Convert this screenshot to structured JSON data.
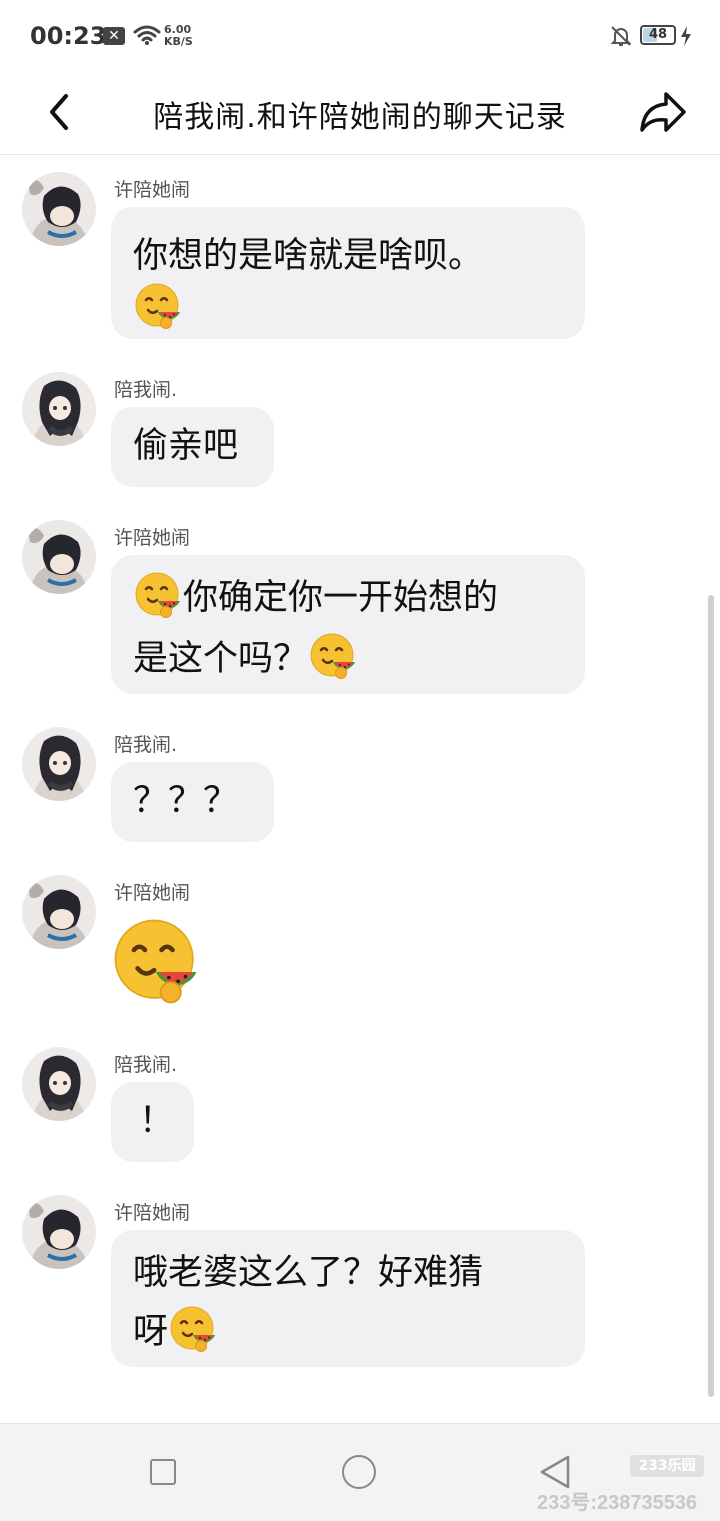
{
  "status_bar": {
    "time": "00:23",
    "notification_badge": "✕",
    "net_speed_value": "6.00",
    "net_speed_unit": "KB/S",
    "battery_level": "48",
    "battery_fraction": 0.48
  },
  "header": {
    "title": "陪我闹.和许陪她闹的聊天记录"
  },
  "messages": [
    {
      "sender": "许陪她闹",
      "line1": "你想的是啥就是啥呗。",
      "line2": ""
    },
    {
      "sender": "陪我闹.",
      "text": "偷亲吧"
    },
    {
      "sender": "许陪她闹",
      "line1": "你确定你一开始想的",
      "line2": "是这个吗？"
    },
    {
      "sender": "陪我闹.",
      "text": "？？？"
    },
    {
      "sender": "许陪她闹"
    },
    {
      "sender": "陪我闹.",
      "text": "！"
    },
    {
      "sender": "许陪她闹",
      "line1": "哦老婆这么了？好难猜",
      "line2": "呀"
    }
  ],
  "icons": {
    "emoji": "yum-watermelon-emoji",
    "back": "chevron-left-icon",
    "share": "share-arrow-icon"
  },
  "watermark": {
    "logo": "233乐园",
    "text": "233号:238735536"
  },
  "colors": {
    "bubble": "#f1f1f3",
    "emoji_face": "#f7c232",
    "emoji_melon": "#e8453c"
  }
}
